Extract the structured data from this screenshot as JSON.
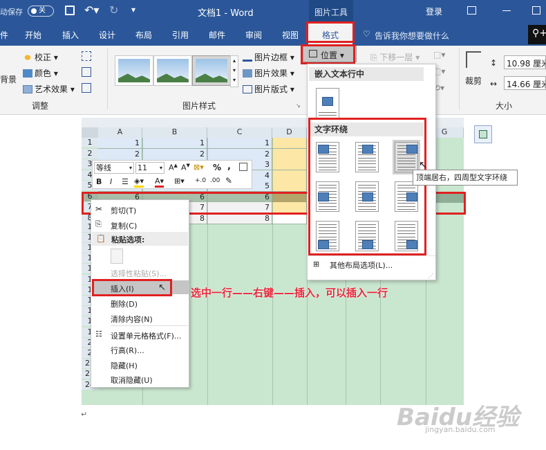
{
  "titlebar": {
    "autosave": "动保存",
    "autosave_state": "关",
    "doc_title": "文档1 - Word",
    "context_tab_group": "图片工具",
    "login": "登录"
  },
  "ribbon_tabs": [
    "开始",
    "插入",
    "设计",
    "布局",
    "引用",
    "邮件",
    "审阅",
    "视图",
    "格式"
  ],
  "tell_me": "告诉我你想要做什么",
  "ribbon": {
    "adjust": {
      "left_cut": "背景",
      "calibrate": "校正 ▾",
      "color": "颜色 ▾",
      "artistic": "艺术效果 ▾",
      "group": "调整"
    },
    "styles": {
      "group": "图片样式"
    },
    "style_cmds": {
      "border": "图片边框 ▾",
      "effect": "图片效果 ▾",
      "layout": "图片版式 ▾"
    },
    "position_btn": "位置 ▾",
    "move_back": "下移一层 ▾",
    "crop": "裁剪",
    "height": "10.98 厘米",
    "width": "14.66 厘米",
    "size_group": "大小"
  },
  "position_menu": {
    "inline_header": "嵌入文本行中",
    "wrap_header": "文字环绕",
    "more": "其他布局选项(L)..."
  },
  "tooltip": "顶端居右，四周型文字环绕",
  "sheet": {
    "columns": [
      "A",
      "B",
      "C",
      "D",
      "",
      "",
      "G"
    ],
    "rows": [
      {
        "n": "1",
        "a": "1",
        "b": "1",
        "c": "1"
      },
      {
        "n": "2",
        "a": "2",
        "b": "2",
        "c": "2"
      },
      {
        "n": "3",
        "a": "",
        "b": "",
        "c": "3"
      },
      {
        "n": "4",
        "a": "",
        "b": "",
        "c": "4"
      },
      {
        "n": "5",
        "a": "",
        "b": "",
        "c": "5"
      },
      {
        "n": "6",
        "a": "6",
        "b": "6",
        "c": "6"
      },
      {
        "n": "7",
        "a": "7",
        "b": "7",
        "c": "7"
      },
      {
        "n": "8",
        "a": "8",
        "b": "8",
        "c": "8"
      }
    ],
    "extra_rows": [
      "1",
      "1",
      "1",
      "1",
      "1",
      "1",
      "1",
      "1",
      "1",
      "1",
      "1",
      "2",
      "2",
      "22",
      "23",
      "24"
    ]
  },
  "mini_toolbar": {
    "font": "等线",
    "size": "11",
    "b": "B",
    "i": "I",
    "percent": "%",
    "comma": ","
  },
  "context_menu": {
    "cut": "剪切(T)",
    "copy": "复制(C)",
    "paste_options": "粘贴选项:",
    "paste_special": "选择性粘贴(S)...",
    "insert": "插入(I)",
    "delete": "删除(D)",
    "clear": "清除内容(N)",
    "format_cells": "设置单元格格式(F)...",
    "row_height": "行高(R)...",
    "hide": "隐藏(H)",
    "unhide": "取消隐藏(U)"
  },
  "annotation": "选中一行——右键——插入，可以插入一行",
  "watermark": "Baidu经验",
  "watermark_url": "jingyan.baidu.com",
  "colors": {
    "word_blue": "#2b579a",
    "highlight_red": "#e02020",
    "sheet_green": "#c9e6cf"
  }
}
